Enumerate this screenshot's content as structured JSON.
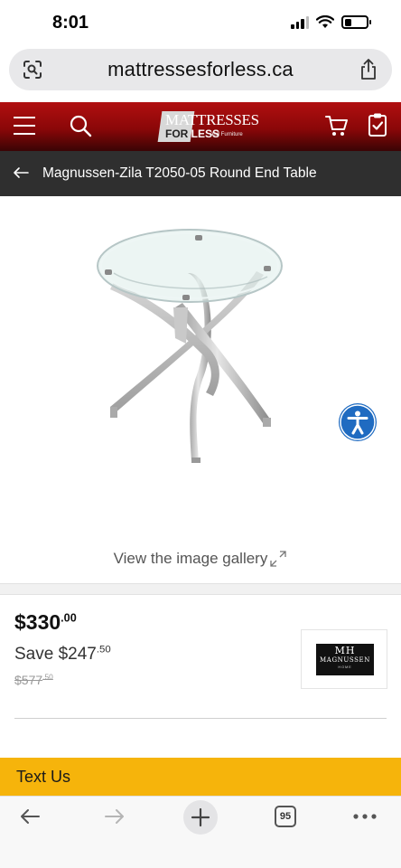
{
  "status_bar": {
    "time": "8:01",
    "icons": [
      "signal-icon",
      "wifi-icon",
      "battery-icon"
    ]
  },
  "browser": {
    "url": "mattressesforless.ca",
    "open_tabs": "95",
    "icons": [
      "lens-icon",
      "share-icon",
      "back-arrow-icon",
      "forward-arrow-icon",
      "plus-icon",
      "more-icon"
    ]
  },
  "site_header": {
    "logo_line1": "MATTRESSES",
    "logo_line2_part1": "FOR ",
    "logo_line2_part2": "LESS",
    "logo_tagline": "and Furniture",
    "icons": [
      "menu-icon",
      "search-icon",
      "cart-icon",
      "clipboard-check-icon"
    ]
  },
  "breadcrumb": {
    "title": "Magnussen-Zila T2050-05 Round End Table"
  },
  "gallery": {
    "link_text": "View the image gallery"
  },
  "pricing": {
    "price_main": "$330",
    "price_cents": ".00",
    "save_label": "Save $247",
    "save_cents": ".50",
    "was_main": "$577",
    "was_cents": ".50"
  },
  "brand": {
    "mark": "MH",
    "name": "MAGNUSSEN",
    "sub": "HOME"
  },
  "text_us": {
    "label": "Text Us"
  },
  "colors": {
    "header_red": "#b10f10",
    "breadcrumb_bg": "#2f2f2f",
    "text_us_bg": "#f6b40b",
    "accessibility_blue": "#1f6bc1"
  }
}
